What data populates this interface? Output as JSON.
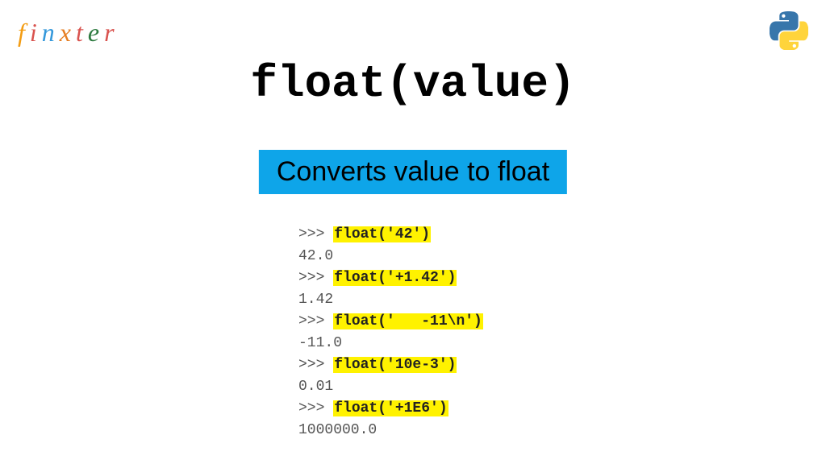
{
  "brand": {
    "letters": [
      "f",
      "i",
      "n",
      "x",
      "t",
      "e",
      "r"
    ]
  },
  "title": "float(value)",
  "subtitle": "Converts value to float",
  "code": {
    "prompt": ">>> ",
    "lines": [
      {
        "call": "float('42')",
        "out": "42.0"
      },
      {
        "call": "float('+1.42')",
        "out": "1.42"
      },
      {
        "call": "float('   -11\\n')",
        "out": "-11.0"
      },
      {
        "call": "float('10e-3')",
        "out": "0.01"
      },
      {
        "call": "float('+1E6')",
        "out": "1000000.0"
      }
    ]
  }
}
